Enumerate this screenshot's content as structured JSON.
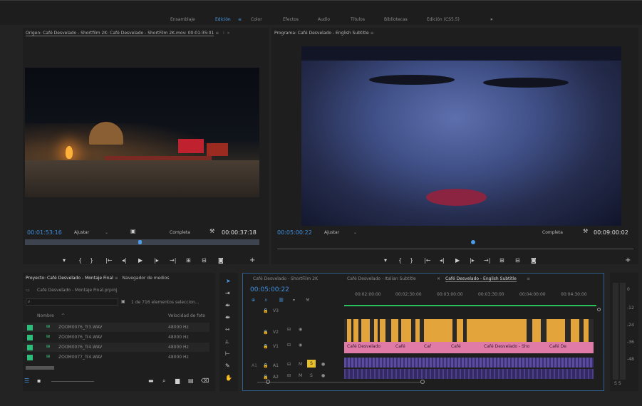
{
  "workspaces": [
    "Ensamblaje",
    "Edición",
    "Color",
    "Efectos",
    "Audio",
    "Títulos",
    "Bibliotecas",
    "Edición (CS5.5)"
  ],
  "active_workspace": "Edición",
  "source": {
    "title": "Origen: Café Desvelado - Shortfilm 2K: Café Desvelado - ShortFilm 2K.mov: 00:01:35:01",
    "timecode": "00:01:53:16",
    "fit": "Ajustar",
    "quality": "Completa",
    "duration": "00:00:37:18"
  },
  "program": {
    "title": "Programa: Café Desvelado - English Subtitle",
    "timecode": "00:05:00:22",
    "fit": "Ajustar",
    "quality": "Completa",
    "duration": "00:09:00:02"
  },
  "project": {
    "tab": "Proyecto: Café Desvelado - Montaje Final",
    "tab2": "Navegador de medios",
    "path": "Café Desvelado - Montaje Final.prproj",
    "count": "1 de 716 elementos seleccion...",
    "col_name": "Nombre",
    "col_rate": "Velocidad de foto",
    "items": [
      {
        "name": "ZOOM0076_Tr3.WAV",
        "rate": "48000 Hz"
      },
      {
        "name": "ZOOM0076_Tr4.WAV",
        "rate": "48000 Hz"
      },
      {
        "name": "ZOOM0076_Tr4.WAV",
        "rate": "48000 Hz"
      },
      {
        "name": "ZOOM0077_Tr4.WAV",
        "rate": "48000 Hz"
      }
    ]
  },
  "timeline": {
    "tabs": [
      "Café Desvelado - ShortFilm 2K",
      "Café Desvelado - Italian Subtitle",
      "Café Desvelado - English Subtitle"
    ],
    "timecode": "00:05:00:22",
    "ruler": [
      "00:02:00:00",
      "00:02:30:00",
      "00:03:00:00",
      "00:03:30:00",
      "00:04:00:00",
      "00:04:30:00"
    ],
    "tracks": [
      "V3",
      "V2",
      "V1",
      "A1",
      "A2"
    ],
    "source_patch": "A1",
    "clip_labels": [
      "Café Desvelado",
      "Café",
      "Caf",
      "Café",
      "Café Desvelado - Sho",
      "Café De"
    ]
  },
  "meter": {
    "labels": [
      "0",
      "-12",
      "-24",
      "-36",
      "-48"
    ],
    "bottom": "S S"
  }
}
